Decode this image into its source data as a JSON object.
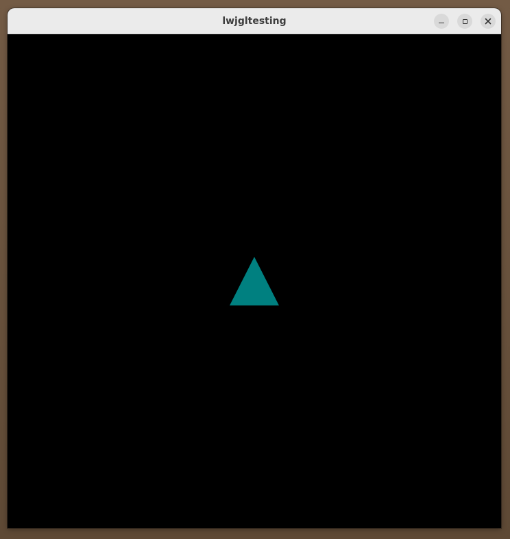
{
  "window": {
    "title": "lwjgltesting"
  },
  "controls": {
    "minimize": "minimize-icon",
    "maximize": "maximize-icon",
    "close": "close-icon"
  },
  "scene": {
    "background_color": "#000000",
    "triangle_color": "#008080"
  },
  "colors": {
    "titlebar": "#ebebeb",
    "title_text": "#3d3d3d",
    "button_bg": "#d9d9d9",
    "desktop": "#6b5541"
  }
}
